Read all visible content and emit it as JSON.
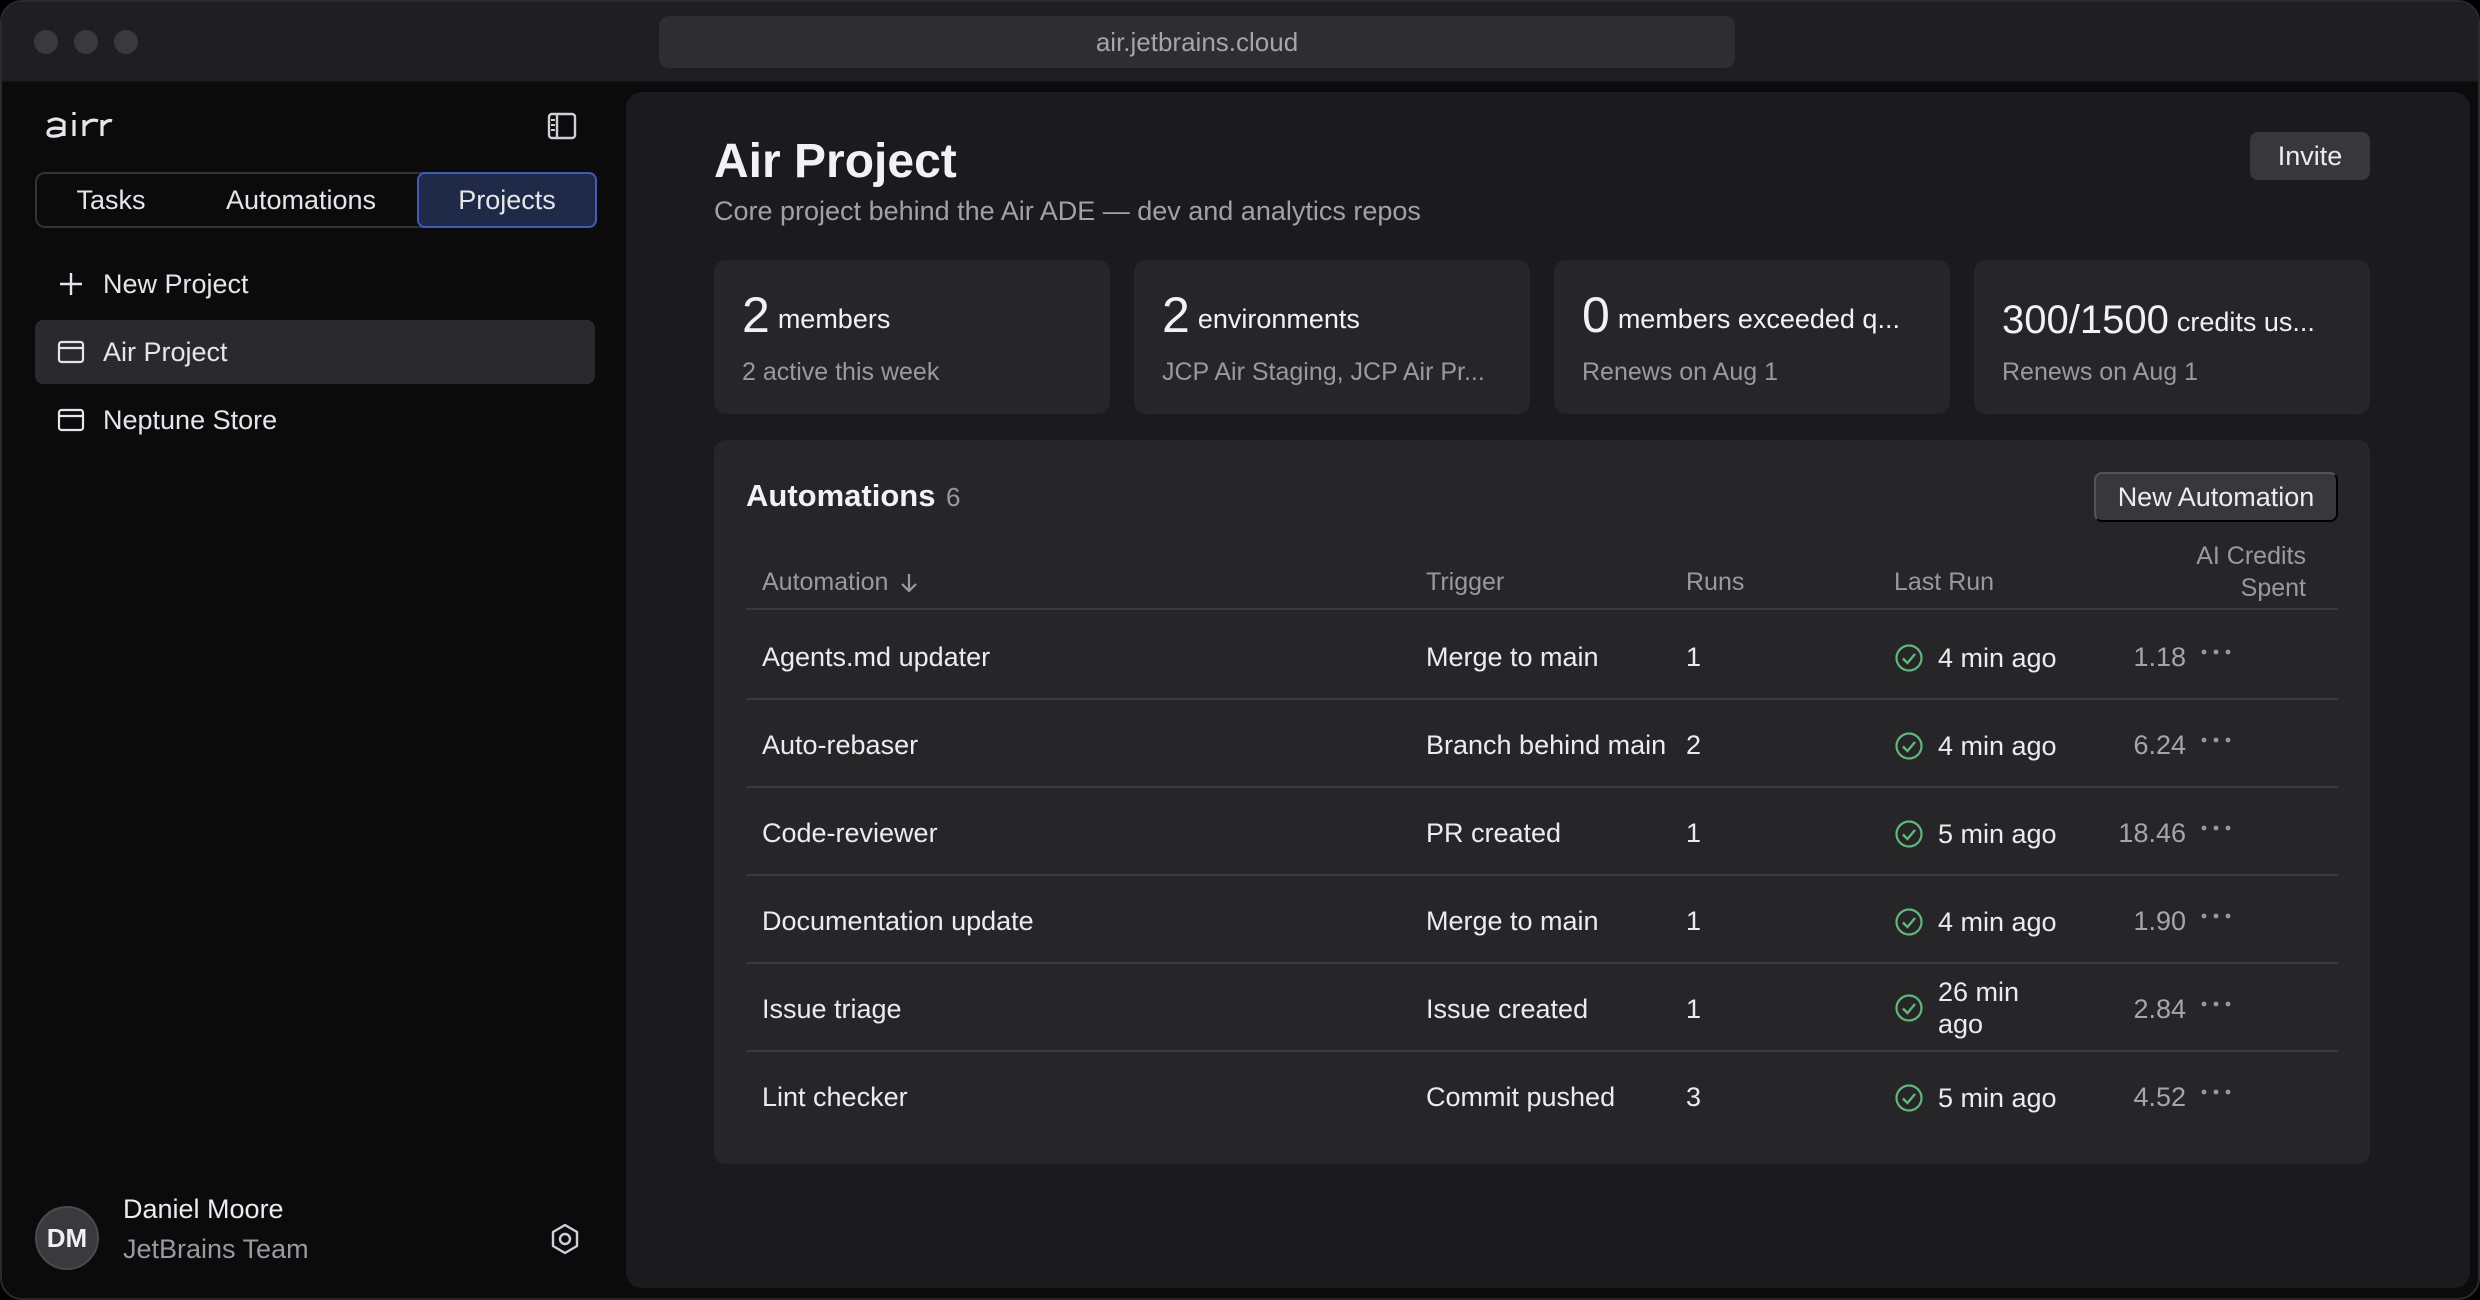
{
  "browser": {
    "url": "air.jetbrains.cloud"
  },
  "sidebar": {
    "tabs": [
      {
        "label": "Tasks"
      },
      {
        "label": "Automations"
      },
      {
        "label": "Projects",
        "active": true
      }
    ],
    "items": [
      {
        "label": "New Project",
        "icon": "plus-icon"
      },
      {
        "label": "Air Project",
        "icon": "window-icon",
        "active": true
      },
      {
        "label": "Neptune Store",
        "icon": "window-icon"
      }
    ],
    "user": {
      "initials": "DM",
      "name": "Daniel Moore",
      "team": "JetBrains Team"
    }
  },
  "main": {
    "title": "Air Project",
    "subtitle": "Core project behind the Air ADE — dev and analytics repos",
    "invite_label": "Invite",
    "stats": [
      {
        "value": "2",
        "unit": "members",
        "note": "2 active this week"
      },
      {
        "value": "2",
        "unit": "environments",
        "note": "JCP Air Staging, JCP Air Pr..."
      },
      {
        "value": "0",
        "unit": "members exceeded q...",
        "note": "Renews on Aug 1"
      },
      {
        "value": "300/1500",
        "unit": "credits us...",
        "note": "Renews on Aug 1"
      }
    ],
    "automations": {
      "title": "Automations",
      "count": "6",
      "new_label": "New Automation",
      "columns": {
        "name": "Automation",
        "trigger": "Trigger",
        "runs": "Runs",
        "last_run": "Last Run",
        "credits_line1": "AI Credits",
        "credits_line2": "Spent"
      },
      "rows": [
        {
          "name": "Agents.md updater",
          "trigger": "Merge to main",
          "runs": "1",
          "last_run": "4 min ago",
          "credits": "1.18"
        },
        {
          "name": "Auto-rebaser",
          "trigger": "Branch behind main",
          "runs": "2",
          "last_run": "4 min ago",
          "credits": "6.24"
        },
        {
          "name": "Code-reviewer",
          "trigger": "PR created",
          "runs": "1",
          "last_run": "5 min ago",
          "credits": "18.46"
        },
        {
          "name": "Documentation update",
          "trigger": "Merge to main",
          "runs": "1",
          "last_run": "4 min ago",
          "credits": "1.90"
        },
        {
          "name": "Issue triage",
          "trigger": "Issue created",
          "runs": "1",
          "last_run_line1": "26 min",
          "last_run_line2": "ago",
          "credits": "2.84"
        },
        {
          "name": "Lint checker",
          "trigger": "Commit pushed",
          "runs": "3",
          "last_run": "5 min ago",
          "credits": "4.52"
        }
      ]
    }
  }
}
